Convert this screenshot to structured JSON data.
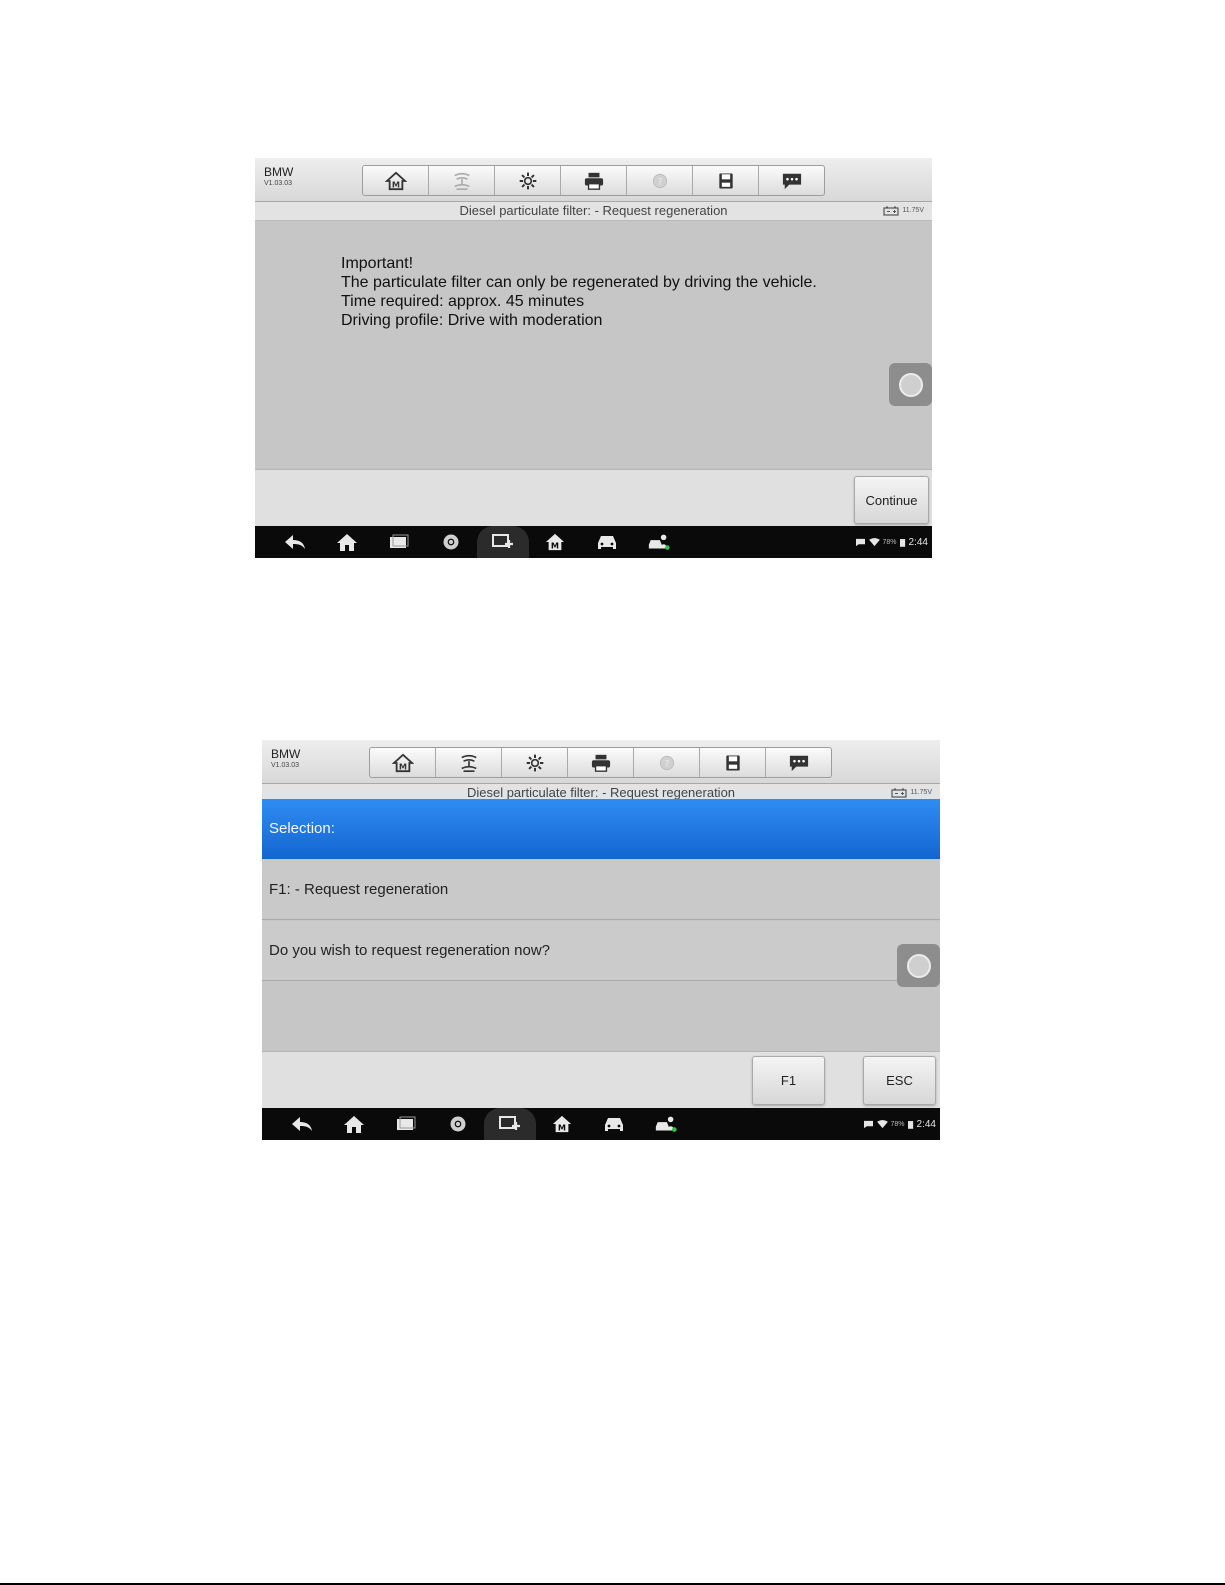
{
  "screen1": {
    "brand": {
      "name": "BMW",
      "version": "V1.03.03"
    },
    "toolbar": {
      "items": [
        {
          "icon": "home-m-icon"
        },
        {
          "icon": "vehicle-lift-icon"
        },
        {
          "icon": "gear-icon"
        },
        {
          "icon": "printer-icon"
        },
        {
          "icon": "help-icon"
        },
        {
          "icon": "save-icon"
        },
        {
          "icon": "feedback-icon"
        }
      ]
    },
    "title": "Diesel particulate filter: - Request regeneration",
    "voltage": "11.75V",
    "message": [
      "Important!",
      "The particulate filter can only be regenerated by driving the vehicle.",
      "Time required: approx. 45 minutes",
      "Driving profile: Drive with moderation"
    ],
    "buttons": {
      "continue": "Continue"
    },
    "status": {
      "battery": "78%",
      "time": "2:44"
    }
  },
  "screen2": {
    "brand": {
      "name": "BMW",
      "version": "V1.03.03"
    },
    "title": "Diesel particulate filter: - Request regeneration",
    "voltage": "11.75V",
    "selection_label": "Selection:",
    "rows": [
      "F1: - Request regeneration",
      "Do you wish to request regeneration now?"
    ],
    "buttons": {
      "f1": "F1",
      "esc": "ESC"
    },
    "status": {
      "battery": "78%",
      "time": "2:44"
    }
  },
  "nav_icons": [
    "back-icon",
    "home-icon",
    "recent-apps-icon",
    "chrome-icon",
    "screen-cast-icon",
    "home-m-icon",
    "car-icon",
    "vehicle-user-icon"
  ]
}
